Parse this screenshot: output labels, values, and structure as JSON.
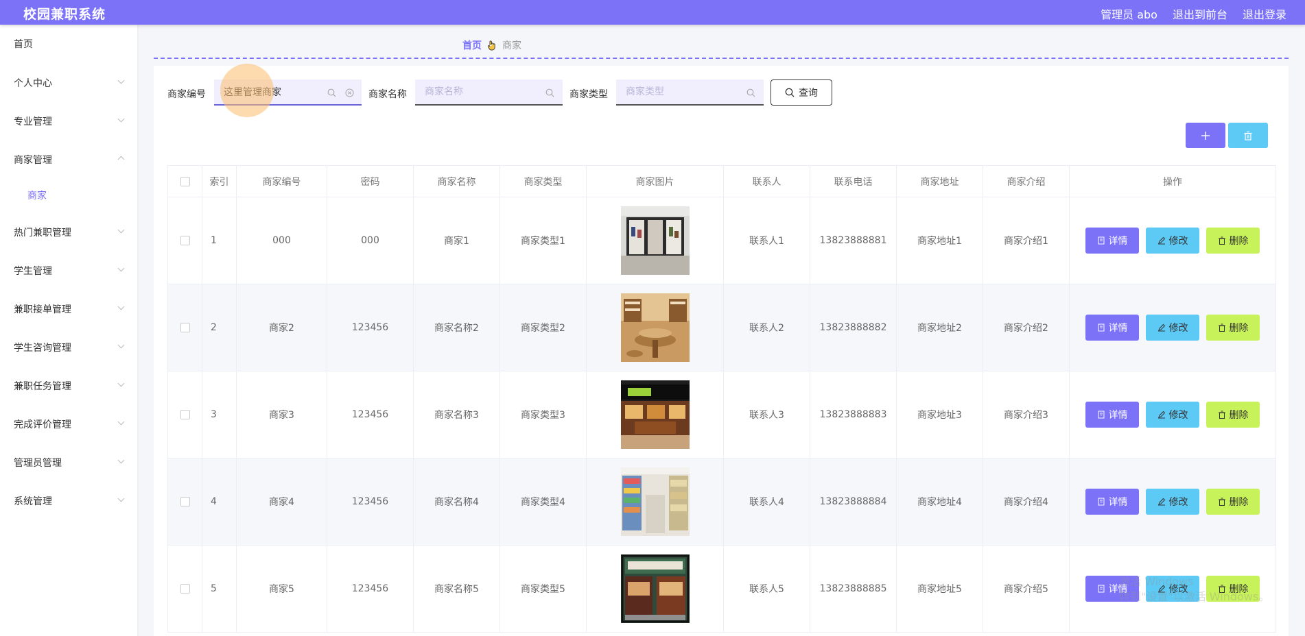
{
  "header": {
    "app_title": "校园兼职系统",
    "user_label": "管理员 abo",
    "front_label": "退出到前台",
    "logout_label": "退出登录",
    "accent_color": "#7b72f7"
  },
  "sidebar": {
    "home": "首页",
    "items": [
      {
        "label": "个人中心"
      },
      {
        "label": "专业管理"
      },
      {
        "label": "商家管理",
        "expanded": true,
        "children": [
          "商家"
        ]
      },
      {
        "label": "热门兼职管理"
      },
      {
        "label": "学生管理"
      },
      {
        "label": "兼职接单管理"
      },
      {
        "label": "学生咨询管理"
      },
      {
        "label": "兼职任务管理"
      },
      {
        "label": "完成评价管理"
      },
      {
        "label": "管理员管理"
      },
      {
        "label": "系统管理"
      }
    ]
  },
  "breadcrumb": {
    "home": "首页",
    "current": "商家"
  },
  "search": {
    "merchant_no_label": "商家编号",
    "merchant_no_value": "这里管理商家",
    "merchant_name_label": "商家名称",
    "merchant_name_placeholder": "商家名称",
    "merchant_type_label": "商家类型",
    "merchant_type_placeholder": "商家类型",
    "query_label": "查询"
  },
  "actions": {
    "add_icon": "plus-icon",
    "delete_icon": "trash-icon"
  },
  "table": {
    "columns": [
      "索引",
      "商家编号",
      "密码",
      "商家名称",
      "商家类型",
      "商家图片",
      "联系人",
      "联系电话",
      "商家地址",
      "商家介绍",
      "操作"
    ],
    "rows": [
      {
        "index": "1",
        "no": "000",
        "password": "000",
        "name": "商家1",
        "type": "商家类型1",
        "contact": "联系人1",
        "phone": "13823888881",
        "address": "商家地址1",
        "intro": "商家介绍1"
      },
      {
        "index": "2",
        "no": "商家2",
        "password": "123456",
        "name": "商家名称2",
        "type": "商家类型2",
        "contact": "联系人2",
        "phone": "13823888882",
        "address": "商家地址2",
        "intro": "商家介绍2"
      },
      {
        "index": "3",
        "no": "商家3",
        "password": "123456",
        "name": "商家名称3",
        "type": "商家类型3",
        "contact": "联系人3",
        "phone": "13823888883",
        "address": "商家地址3",
        "intro": "商家介绍3"
      },
      {
        "index": "4",
        "no": "商家4",
        "password": "123456",
        "name": "商家名称4",
        "type": "商家类型4",
        "contact": "联系人4",
        "phone": "13823888884",
        "address": "商家地址4",
        "intro": "商家介绍4"
      },
      {
        "index": "5",
        "no": "商家5",
        "password": "123456",
        "name": "商家名称5",
        "type": "商家类型5",
        "contact": "联系人5",
        "phone": "13823888885",
        "address": "商家地址5",
        "intro": "商家介绍5"
      }
    ],
    "ops": {
      "detail": "详情",
      "edit": "修改",
      "delete": "删除"
    }
  },
  "watermark": {
    "line1": "激活 Windows",
    "line2": "转到\"设置\"以激活 Windows。"
  }
}
